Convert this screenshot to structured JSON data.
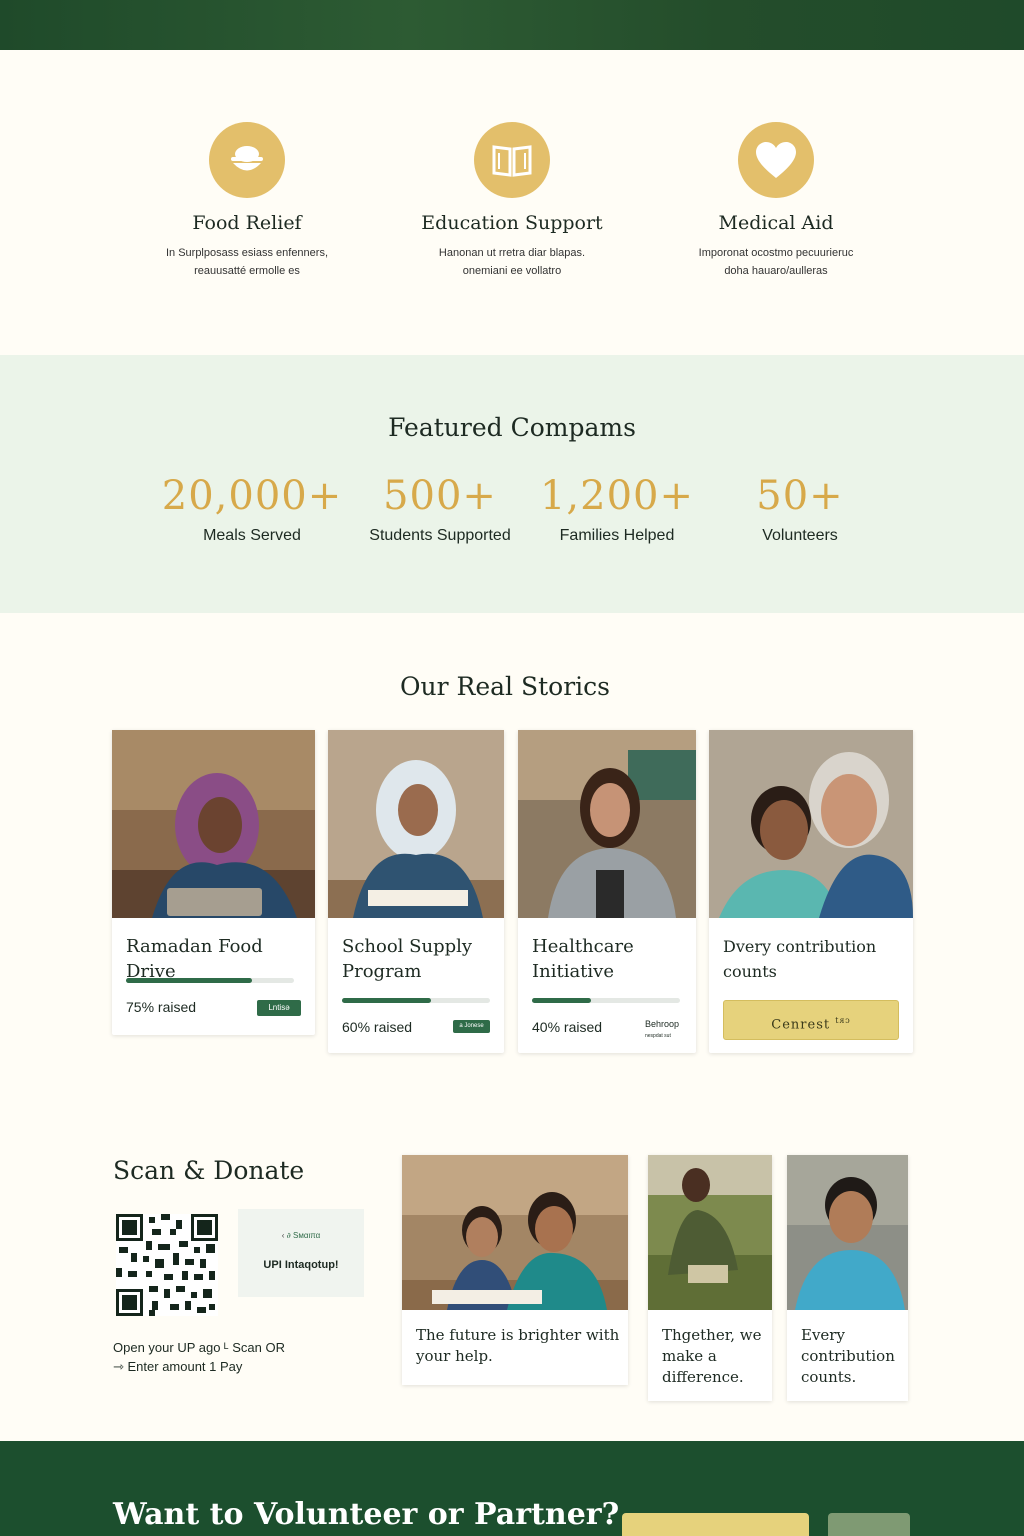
{
  "services": [
    {
      "title": "Food Relief",
      "desc_line1": "In Surplposass esiass enfenners,",
      "desc_line2": "reauusatté ermolle es",
      "icon": "bowl-icon"
    },
    {
      "title": "Education Support",
      "desc_line1": "Hanonan ut rretra diar blapas.",
      "desc_line2": "onemiani ee vollatro",
      "icon": "book-icon"
    },
    {
      "title": "Medical Aid",
      "desc_line1": "Imporonat ocostmo pecuurieruc",
      "desc_line2": "doha hauaro/aulleras",
      "icon": "heart-icon"
    }
  ],
  "stats": {
    "title": "Featured Compams",
    "items": [
      {
        "value": "20,000+",
        "label": "Meals Served"
      },
      {
        "value": "500+",
        "label": "Students Supported"
      },
      {
        "value": "1,200+",
        "label": "Families Helped"
      },
      {
        "value": "50+",
        "label": "Volunteers"
      }
    ]
  },
  "stories": {
    "title": "Our Real Storics",
    "cards": [
      {
        "title": "Ramadan Food Drive",
        "raised": "75% raised",
        "progress": 0.75,
        "tag": "Lntisə"
      },
      {
        "title": "School Supply Program",
        "raised": "60% raised",
        "progress": 0.6,
        "tag": "a Jonese"
      },
      {
        "title": "Healthcare Initiative",
        "raised": "40% raised",
        "progress": 0.4,
        "tag": "Behroop",
        "tag_sub": "nespdat  sut"
      },
      {
        "title": "Dvery contribution counts",
        "button": "Cenrest",
        "button_sup": "tᴙᴐ"
      }
    ]
  },
  "scan": {
    "title": "Scan & Donate",
    "upi_small": "Sмαιπα",
    "upi_label": "UPI Intaqotup!",
    "step1": "Open your UP ago ᴸ Scan OR",
    "step2": "⇾ Enter amount 1 Pay"
  },
  "quotes": [
    {
      "text": "The future is brighter with your help."
    },
    {
      "text": "Thgether, we make a difference."
    },
    {
      "text": "Every contribution counts."
    }
  ],
  "volunteer": {
    "title": "Want to Volunteer or Partner?"
  },
  "colors": {
    "brand_green": "#1c4f2e",
    "accent_gold": "#e3bf6b",
    "stat_gold": "#d7a94a",
    "soft_green": "#ebf4e9"
  }
}
